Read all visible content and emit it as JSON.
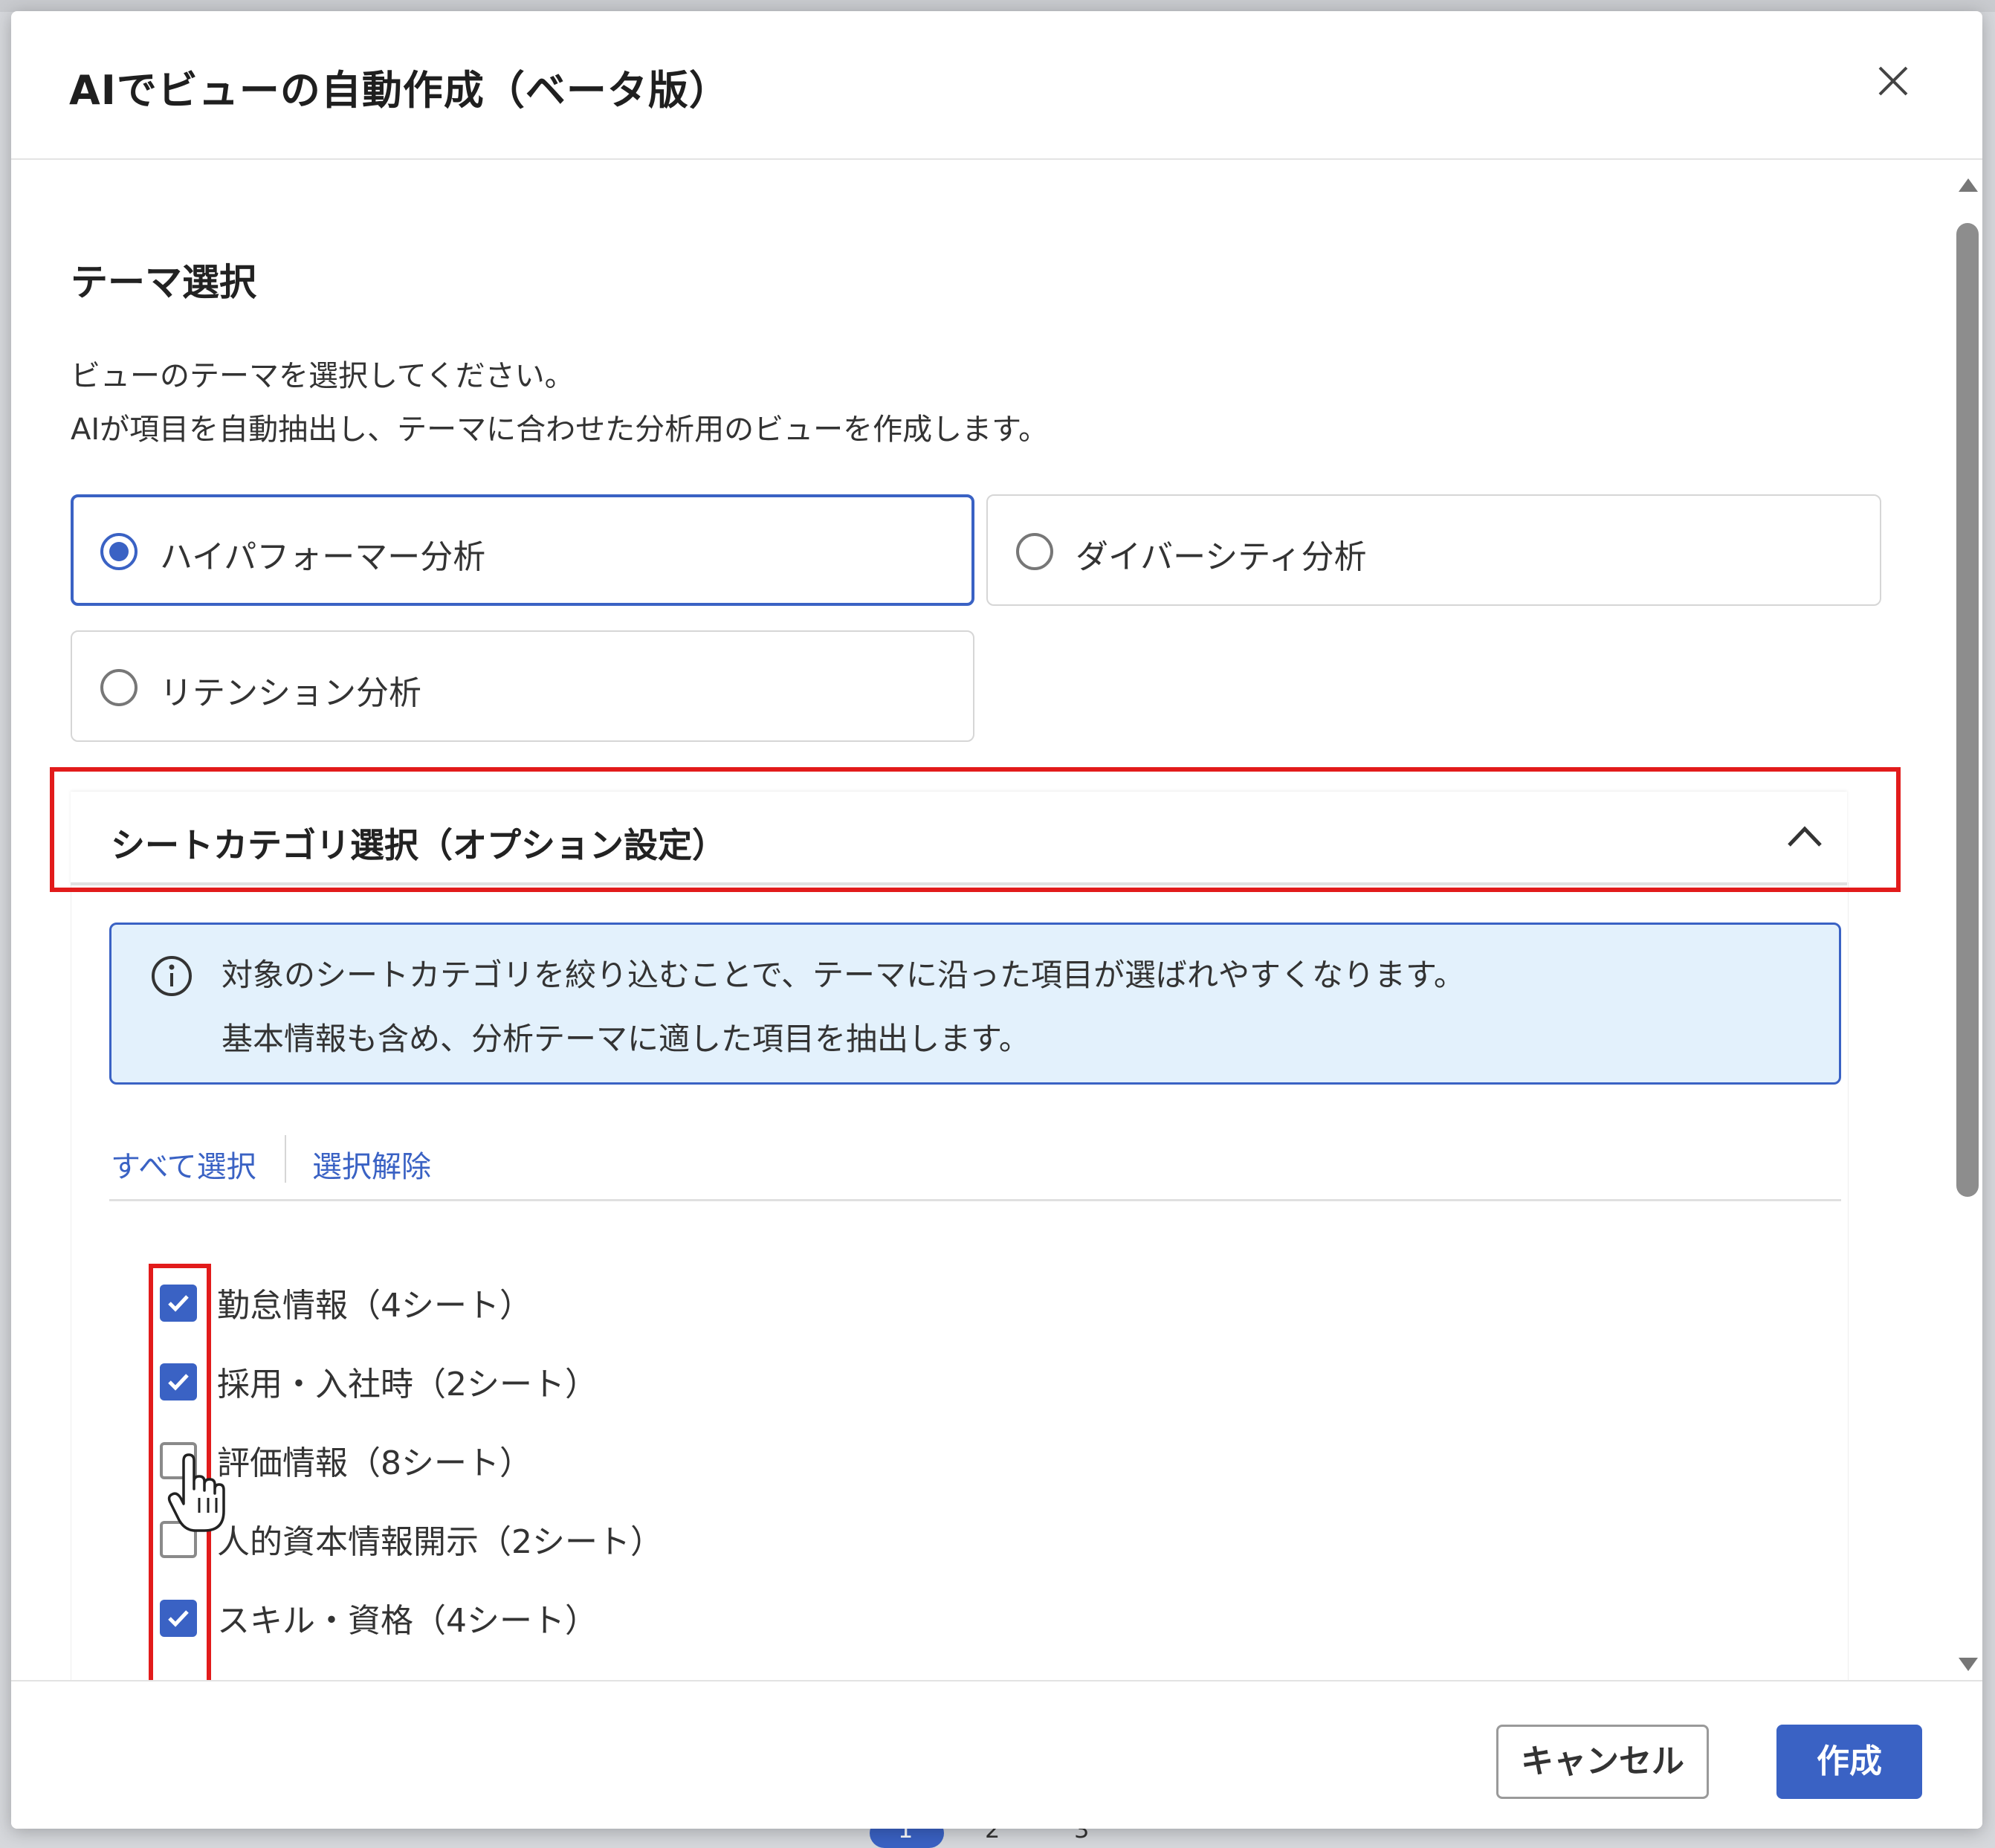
{
  "dialog": {
    "title": "AIでビューの自動作成（ベータ版）",
    "close_icon": "close-icon"
  },
  "theme": {
    "heading": "テーマ選択",
    "description_line1": "ビューのテーマを選択してください。",
    "description_line2": "AIが項目を自動抽出し、テーマに合わせた分析用のビューを作成します。",
    "options": [
      {
        "label": "ハイパフォーマー分析",
        "selected": true
      },
      {
        "label": "ダイバーシティ分析",
        "selected": false
      },
      {
        "label": "リテンション分析",
        "selected": false
      }
    ]
  },
  "sheet_category": {
    "heading": "シートカテゴリ選択（オプション設定）",
    "expanded": true,
    "info_line1": "対象のシートカテゴリを絞り込むことで、テーマに沿った項目が選ばれやすくなります。",
    "info_line2": "基本情報も含め、分析テーマに適した項目を抽出します。",
    "select_all": "すべて選択",
    "deselect": "選択解除",
    "items": [
      {
        "label": "勤怠情報（4シート）",
        "checked": true
      },
      {
        "label": "採用・入社時（2シート）",
        "checked": true
      },
      {
        "label": "評価情報（8シート）",
        "checked": false
      },
      {
        "label": "人的資本情報開示（2シート）",
        "checked": false
      },
      {
        "label": "スキル・資格（4シート）",
        "checked": true
      }
    ]
  },
  "footer": {
    "cancel": "キャンセル",
    "create": "作成"
  },
  "background_pager": [
    "1",
    "2",
    "3"
  ],
  "colors": {
    "accent": "#3a62c4",
    "highlight": "#e21b1b",
    "info_bg": "#e3f1fc"
  }
}
